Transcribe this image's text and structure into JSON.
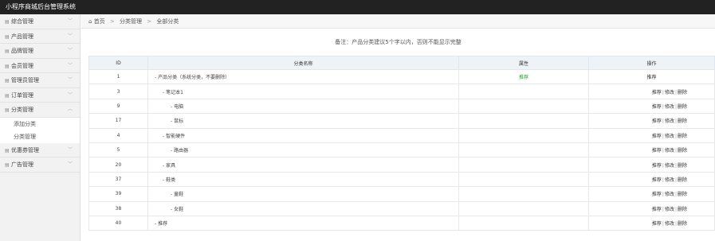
{
  "app_title": "小程序商城后台管理系统",
  "sidebar": {
    "items": [
      {
        "label": "综合管理",
        "icon": "dashboard-icon"
      },
      {
        "label": "产品管理",
        "icon": "product-icon"
      },
      {
        "label": "品牌管理",
        "icon": "brand-icon"
      },
      {
        "label": "会员管理",
        "icon": "member-icon"
      },
      {
        "label": "管理员管理",
        "icon": "admin-icon"
      },
      {
        "label": "订单管理",
        "icon": "order-icon"
      },
      {
        "label": "分类管理",
        "icon": "category-icon",
        "expanded": true,
        "children": [
          {
            "label": "添加分类"
          },
          {
            "label": "分类管理"
          }
        ]
      },
      {
        "label": "优惠券管理",
        "icon": "coupon-icon"
      },
      {
        "label": "广告管理",
        "icon": "ad-icon"
      }
    ]
  },
  "breadcrumb": {
    "home": "首页",
    "level1": "分类管理",
    "level2": "全部分类",
    "sep": ">"
  },
  "notice": "备注：产品分类建议5个字以内，否则不能显示完整",
  "table": {
    "headers": {
      "id": "ID",
      "name": "分类名称",
      "attr": "属性",
      "ops": "操作"
    },
    "rows": [
      {
        "id": "1",
        "name": "- 产品分类（系统分类，不要删除）",
        "indent": 0,
        "attr": "推荐",
        "ops": [
          "推荐"
        ]
      },
      {
        "id": "3",
        "name": "- 笔记本1",
        "indent": 1,
        "attr": "",
        "ops": [
          "推荐",
          "修改",
          "删除"
        ]
      },
      {
        "id": "9",
        "name": "- 电脑",
        "indent": 2,
        "attr": "",
        "ops": [
          "推荐",
          "修改",
          "删除"
        ]
      },
      {
        "id": "17",
        "name": "- 鼠标",
        "indent": 2,
        "attr": "",
        "ops": [
          "推荐",
          "修改",
          "删除"
        ]
      },
      {
        "id": "4",
        "name": "- 智能硬件",
        "indent": 1,
        "attr": "",
        "ops": [
          "推荐",
          "修改",
          "删除"
        ]
      },
      {
        "id": "5",
        "name": "- 路由器",
        "indent": 2,
        "attr": "",
        "ops": [
          "推荐",
          "修改",
          "删除"
        ]
      },
      {
        "id": "20",
        "name": "- 家具",
        "indent": 1,
        "attr": "",
        "ops": [
          "推荐",
          "修改",
          "删除"
        ]
      },
      {
        "id": "37",
        "name": "- 鞋类",
        "indent": 1,
        "attr": "",
        "ops": [
          "推荐",
          "修改",
          "删除"
        ]
      },
      {
        "id": "39",
        "name": "- 童鞋",
        "indent": 2,
        "attr": "",
        "ops": [
          "推荐",
          "修改",
          "删除"
        ]
      },
      {
        "id": "38",
        "name": "- 女鞋",
        "indent": 2,
        "attr": "",
        "ops": [
          "推荐",
          "修改",
          "删除"
        ]
      },
      {
        "id": "40",
        "name": "- 推荐",
        "indent": 0,
        "attr": "",
        "ops": [
          "推荐",
          "修改",
          "删除"
        ]
      }
    ]
  },
  "colors": {
    "topbar": "#222222",
    "recommend": "#2aa52a"
  }
}
